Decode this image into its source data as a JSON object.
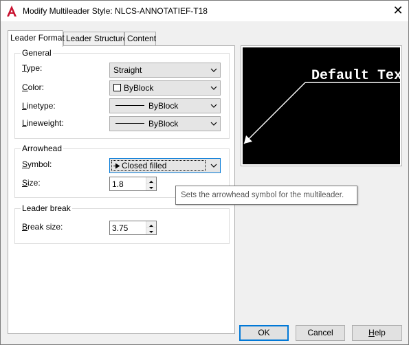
{
  "window": {
    "title": "Modify Multileader Style: NLCS-ANNOTATIEF-T18",
    "close_glyph": "✕",
    "app_icon": "autocad-icon",
    "app_icon_color": "#c8102e"
  },
  "tabs": [
    {
      "label": "Leader Format",
      "active": true
    },
    {
      "label": "Leader Structure",
      "active": false
    },
    {
      "label": "Content",
      "active": false
    }
  ],
  "general": {
    "title": "General",
    "type": {
      "label_hot": "T",
      "label_rest": "ype:",
      "value": "Straight"
    },
    "color": {
      "label_hot": "C",
      "label_rest": "olor:",
      "value": "ByBlock"
    },
    "linetype": {
      "label_hot": "L",
      "label_rest": "inetype:",
      "value": "ByBlock"
    },
    "lineweight": {
      "label_hot": "L",
      "label_rest": "ineweight:",
      "value": "ByBlock"
    }
  },
  "arrowhead": {
    "title": "Arrowhead",
    "symbol": {
      "label_hot": "S",
      "label_rest": "ymbol:",
      "value": "Closed filled"
    },
    "size": {
      "label_hot": "S",
      "label_rest": "ize:",
      "value": "1.8"
    }
  },
  "leader_break": {
    "title": "Leader break",
    "break_size": {
      "label_hot": "B",
      "label_rest": "reak size:",
      "value": "3.75"
    }
  },
  "preview": {
    "text": "Default Text",
    "background": "#000000",
    "foreground": "#ffffff"
  },
  "tooltip": {
    "text": "Sets the arrowhead symbol for the multileader."
  },
  "buttons": {
    "ok": "OK",
    "cancel": "Cancel",
    "help_hot": "H",
    "help_rest": "elp"
  }
}
